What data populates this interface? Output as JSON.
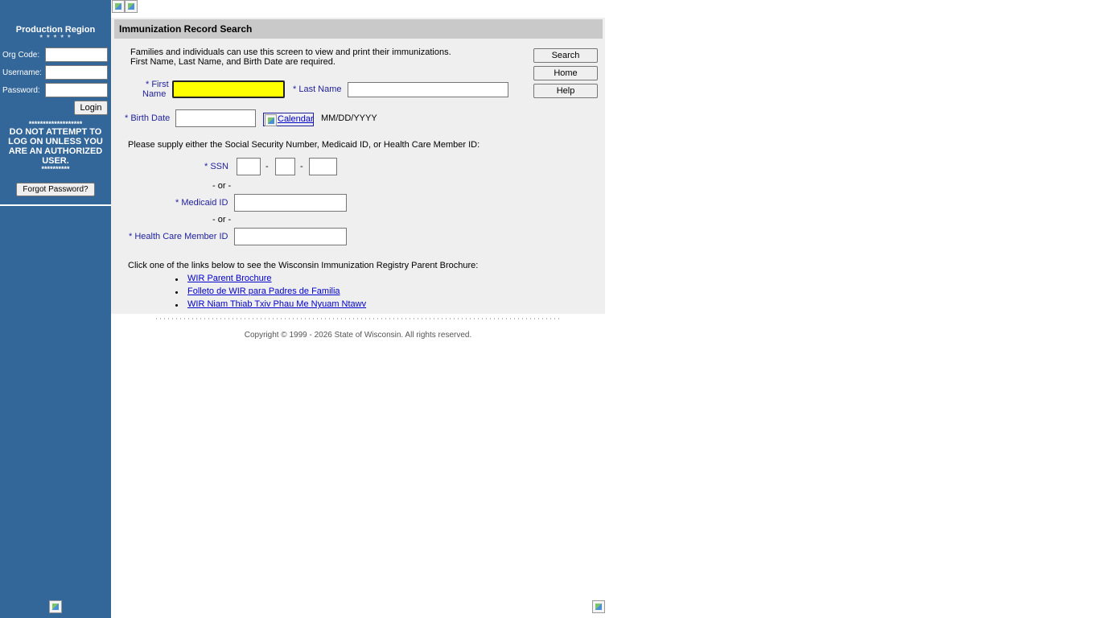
{
  "sidebar": {
    "region": "Production Region",
    "stars": "* * * * *",
    "org_code_label": "Org Code:",
    "username_label": "Username:",
    "password_label": "Password:",
    "login_button": "Login",
    "warning_stars_top": "*******************",
    "warning_line1": "DO NOT ATTEMPT TO",
    "warning_line2": "LOG ON UNLESS YOU",
    "warning_line3": "ARE AN AUTHORIZED",
    "warning_line4": "USER.",
    "warning_stars_bottom": "**********",
    "forgot_button": "Forgot Password?"
  },
  "main": {
    "title": "Immunization Record Search",
    "intro_line1": "Families and individuals can use this screen to view and print their immunizations.",
    "intro_line2": "First Name, Last Name, and Birth Date are required.",
    "buttons": {
      "search": "Search",
      "home": "Home",
      "help": "Help"
    },
    "first_name_label_1": "* First",
    "first_name_label_2": "Name",
    "last_name_label": "* Last Name",
    "birth_date_label": "* Birth Date",
    "calendar_link": "Calendar",
    "date_format": "MM/DD/YYYY",
    "supply_text": "Please supply either the Social Security Number, Medicaid ID, or Health Care Member ID:",
    "ssn_label": "* SSN",
    "dash": "-",
    "or_text": "- or -",
    "medicaid_label": "* Medicaid ID",
    "hc_member_label": "* Health Care Member ID",
    "brochure_text": "Click one of the links below to see the Wisconsin Immunization Registry Parent Brochure:",
    "links": [
      "WIR Parent Brochure",
      "Folleto de WIR para Padres de Familia",
      "WIR Niam Thiab Txiv Phau Me Nyuam Ntawv"
    ]
  },
  "footer": {
    "copyright": "Copyright © 1999 - 2026 State of Wisconsin. All rights reserved."
  }
}
